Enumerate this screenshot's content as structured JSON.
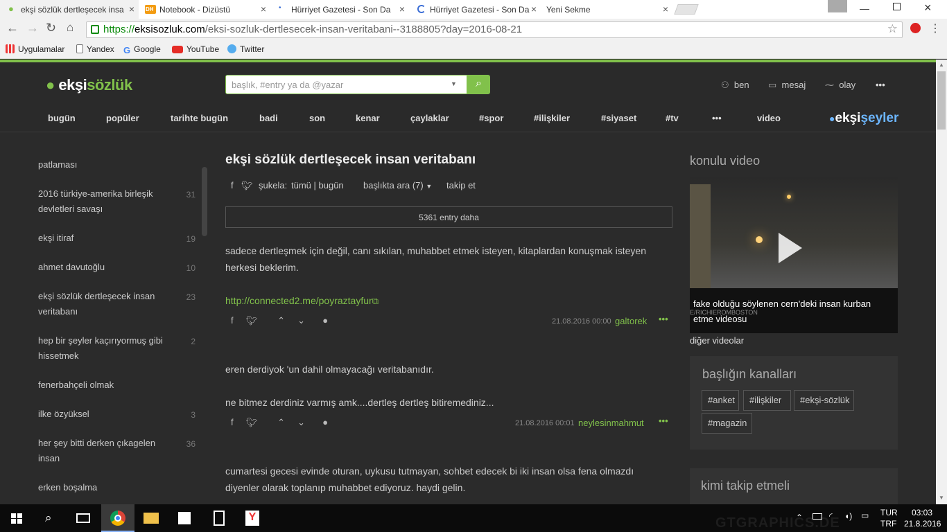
{
  "browser": {
    "tabs": [
      {
        "title": "ekşi sözlük dertleşecek insa",
        "active": true
      },
      {
        "title": "Notebook - Dizüstü",
        "active": false
      },
      {
        "title": "Hürriyet Gazetesi - Son Da",
        "active": false
      },
      {
        "title": "Hürriyet Gazetesi - Son Da",
        "active": false
      },
      {
        "title": "Yeni Sekme",
        "active": false
      }
    ],
    "url_scheme": "https://",
    "url_domain": "eksisozluk.com",
    "url_path": "/eksi-sozluk-dertlesecek-insan-veritabani--3188805?day=2016-08-21",
    "bookmarks": [
      "Uygulamalar",
      "Yandex",
      "Google",
      "YouTube",
      "Twitter"
    ]
  },
  "site": {
    "logo": {
      "a": "ekşi",
      "b": "sözlük"
    },
    "search_placeholder": "başlık, #entry ya da @yazar",
    "user_menu": {
      "ben": "ben",
      "mesaj": "mesaj",
      "olay": "olay",
      "more": "•••"
    },
    "nav": [
      "bugün",
      "popüler",
      "tarihte bugün",
      "badi",
      "son",
      "kenar",
      "çaylaklar",
      "#spor",
      "#ilişkiler",
      "#siyaset",
      "#tv",
      "•••",
      "video"
    ],
    "eksiseyler": {
      "a": "ekşi",
      "b": "şeyler"
    }
  },
  "left_topics": [
    {
      "label": "patlaması",
      "count": ""
    },
    {
      "label": "2016 türkiye-amerika birleşik devletleri savaşı",
      "count": "31"
    },
    {
      "label": "ekşi itiraf",
      "count": "19"
    },
    {
      "label": "ahmet davutoğlu",
      "count": "10"
    },
    {
      "label": "ekşi sözlük dertleşecek insan veritabanı",
      "count": "23"
    },
    {
      "label": "hep bir şeyler kaçırıyormuş gibi hissetmek",
      "count": "2"
    },
    {
      "label": "fenerbahçeli olmak",
      "count": ""
    },
    {
      "label": "ilke özyüksel",
      "count": "3"
    },
    {
      "label": "her şey bitti derken çıkagelen insan",
      "count": "36"
    },
    {
      "label": "erken boşalma",
      "count": ""
    }
  ],
  "topic": {
    "title": "ekşi sözlük dertleşecek insan veritabanı",
    "sukela": "şukela:",
    "tumu": "tümü | bugün",
    "baslikta_ara": "başlıkta ara (7)",
    "takip": "takip et",
    "more_entries": "5361 entry daha"
  },
  "entries": [
    {
      "text": "sadece dertleşmek için değil, canı sıkılan, muhabbet etmek isteyen, kitaplardan konuşmak isteyen herkesi beklerim.",
      "link": "http://connected2.me/poyraztayfur",
      "date": "21.08.2016 00:00",
      "author": "galtorek"
    },
    {
      "text": "eren derdiyok 'un dahil olmayacağı veritabanıdır.",
      "text2": "ne bitmez derdiniz varmış amk....dertleş dertleş bitiremediniz...",
      "date": "21.08.2016 00:01",
      "author": "neylesinmahmut"
    },
    {
      "text": "cumartesi gecesi evinde oturan, uykusu tutmayan, sohbet edecek bi iki insan olsa fena olmazdı diyenler olarak toplanıp muhabbet ediyoruz. haydi gelin."
    }
  ],
  "right": {
    "konulu_video": "konulu video",
    "video_caption": "fake olduğu söylenen cern'deki insan kurban etme videosu",
    "video_watermark": "E/RICHIEROMBOSTON",
    "diger_videolar": "diğer videolar",
    "kanallar_title": "başlığın kanalları",
    "tags": [
      "#anket",
      "#ilişkiler",
      "#ekşi-sözlük",
      "#magazin"
    ],
    "kimi_takip": "kimi takip etmeli"
  },
  "taskbar": {
    "lang": "TUR",
    "lang2": "TRF",
    "time": "03:03",
    "date": "21.8.2016",
    "watermark": "GTGRAPHICS.DE"
  },
  "colors": {
    "accent": "#81c14b",
    "bg": "#2b2b2b"
  }
}
